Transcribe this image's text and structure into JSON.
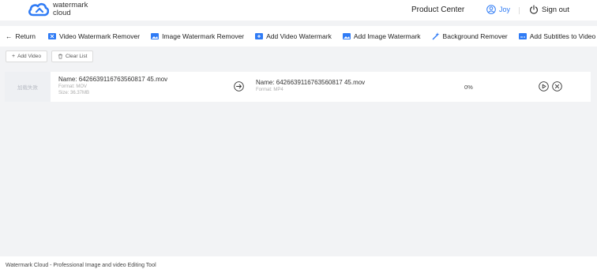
{
  "header": {
    "brand_line1": "watermark",
    "brand_line2": "cloud",
    "product_center": "Product Center",
    "user_name": "Joy",
    "sign_out": "Sign out"
  },
  "nav": {
    "return_label": "Return",
    "items": [
      "Video Watermark Remover",
      "Image Watermark Remover",
      "Add Video Watermark",
      "Add Image Watermark",
      "Background Remover",
      "Add Subtitles to Video"
    ]
  },
  "toolbar": {
    "add_video": "Add Video",
    "clear_list": "Clear List"
  },
  "file": {
    "thumbnail_text": "加载失败",
    "source_name": "Name: 6426639116763560817 45.mov",
    "source_format": "Format: MOV",
    "source_size": "Size: 36.37MB",
    "output_name": "Name: 6426639116763560817 45.mov",
    "output_format": "Format: MP4",
    "progress": "0%"
  },
  "footer": {
    "text": "Watermark Cloud - Professional Image and video Editing Tool"
  },
  "colors": {
    "accent": "#2f7bf5",
    "background": "#f2f3f5"
  }
}
